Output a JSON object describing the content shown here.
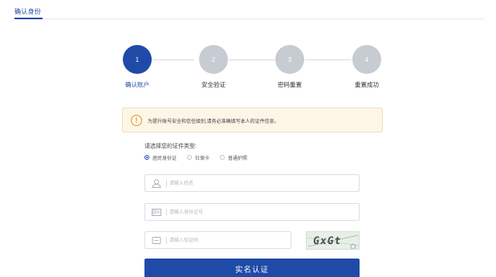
{
  "header": {
    "tab_label": "确认身份"
  },
  "steps": [
    {
      "number": "1",
      "label": "确认账户",
      "active": true
    },
    {
      "number": "2",
      "label": "安全验证",
      "active": false
    },
    {
      "number": "3",
      "label": "密码重置",
      "active": false
    },
    {
      "number": "4",
      "label": "重置成功",
      "active": false
    }
  ],
  "notice": {
    "text": "为提升账号安全和信任级别,请务必准确填写本人的证件信息。"
  },
  "id_type": {
    "label": "请选择您的证件类型:",
    "options": [
      {
        "label": "居民身份证",
        "checked": true
      },
      {
        "label": "社保卡",
        "checked": false
      },
      {
        "label": "普通护照",
        "checked": false
      }
    ]
  },
  "form": {
    "name_placeholder": "请输入姓名",
    "id_placeholder": "请输入身份证号",
    "captcha_placeholder": "请输入验证码",
    "captcha_text": "GxGt",
    "submit_label": "实名认证"
  },
  "colors": {
    "primary": "#1f4aa8",
    "inactive_step": "#c7cbd2",
    "notice_bg": "#fdf6e7",
    "warning": "#d89a2a"
  }
}
